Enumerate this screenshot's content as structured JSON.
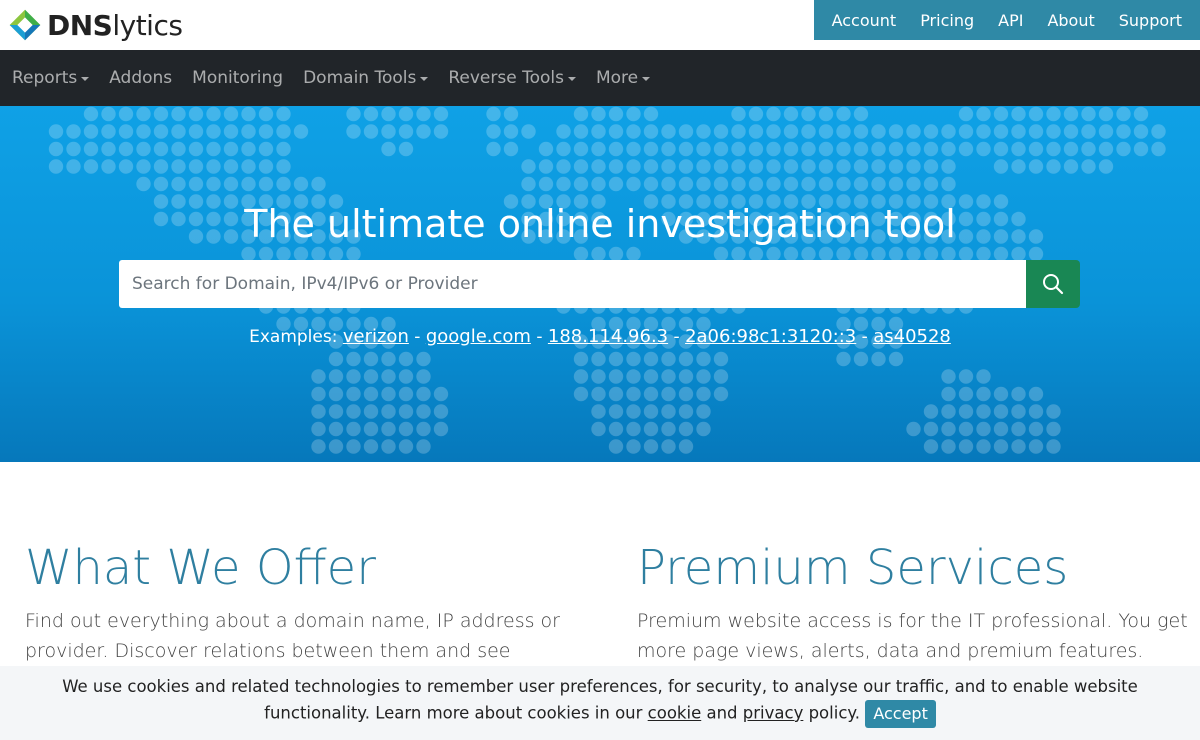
{
  "brand": {
    "name_bold": "DNS",
    "name_regular": "lytics",
    "icon": "dnslytics-diamond-logo-icon"
  },
  "top_links": [
    "Account",
    "Pricing",
    "API",
    "About",
    "Support"
  ],
  "nav": [
    {
      "label": "Reports",
      "dropdown": true
    },
    {
      "label": "Addons",
      "dropdown": false
    },
    {
      "label": "Monitoring",
      "dropdown": false
    },
    {
      "label": "Domain Tools",
      "dropdown": true
    },
    {
      "label": "Reverse Tools",
      "dropdown": true
    },
    {
      "label": "More",
      "dropdown": true
    }
  ],
  "hero": {
    "title": "The ultimate online investigation tool",
    "search_placeholder": "Search for Domain, IPv4/IPv6 or Provider",
    "search_value": "",
    "search_icon": "magnifier-icon",
    "examples_label": "Examples:",
    "separator": " - ",
    "examples": [
      "verizon",
      "google.com",
      "188.114.96.3",
      "2a06:98c1:3120::3",
      "as40528"
    ]
  },
  "offer": {
    "title": "What We Offer",
    "text": "Find out everything about a domain name, IP address or provider. Discover relations between them and see historical"
  },
  "premium": {
    "title": "Premium Services",
    "text": "Premium website access is for the IT professional. You get more page views, alerts, data and premium features. Month"
  },
  "cookie": {
    "text_before": "We use cookies and related technologies to remember user preferences, for security, to analyse our traffic, and to enable website functionality. Learn more about cookies in our ",
    "cookie_link": "cookie",
    "and": " and ",
    "privacy_link": "privacy",
    "text_after": " policy. ",
    "accept_label": "Accept"
  },
  "colors": {
    "brand_teal": "#2f89a6",
    "nav_bg": "#212529",
    "hero_blue": "#0a93d8",
    "search_green": "#198754",
    "heading_blue": "#2f7fa0"
  }
}
